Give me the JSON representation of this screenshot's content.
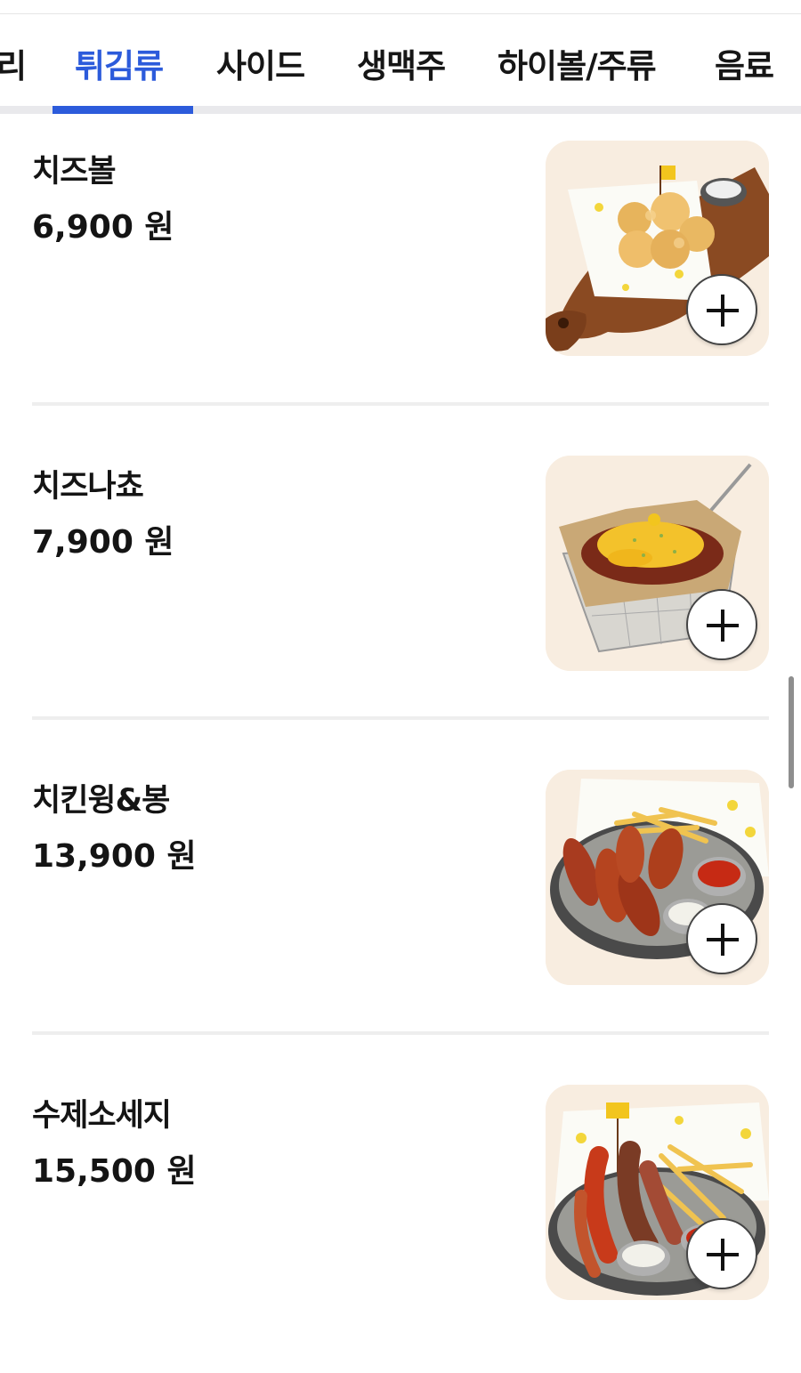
{
  "tabs": {
    "items": [
      {
        "label": "리",
        "active": false
      },
      {
        "label": "튀김류",
        "active": true
      },
      {
        "label": "사이드",
        "active": false
      },
      {
        "label": "생맥주",
        "active": false
      },
      {
        "label": "하이볼/주류",
        "active": false
      },
      {
        "label": "음료",
        "active": false
      }
    ]
  },
  "menu": {
    "items": [
      {
        "name": "치즈볼",
        "price": "6,900 원",
        "image": "cheese-ball-photo",
        "add_icon": "plus-icon"
      },
      {
        "name": "치즈나쵸",
        "price": "7,900 원",
        "image": "cheese-nachos-photo",
        "add_icon": "plus-icon"
      },
      {
        "name": "치킨윙&봉",
        "price": "13,900 원",
        "image": "chicken-wings-photo",
        "add_icon": "plus-icon"
      },
      {
        "name": "수제소세지",
        "price": "15,500 원",
        "image": "handmade-sausage-photo",
        "add_icon": "plus-icon"
      }
    ]
  },
  "colors": {
    "accent": "#2c5bdb",
    "text": "#141414",
    "divider": "#eeeeee",
    "thumb_bg": "#f8ede0"
  }
}
